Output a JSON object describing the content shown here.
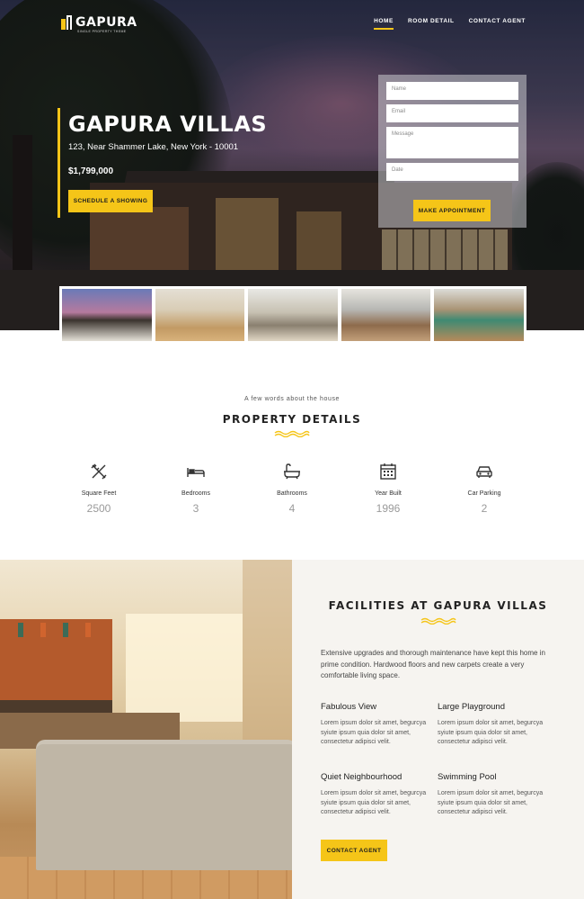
{
  "brand": {
    "name": "GAPURA",
    "tagline": "SINGLE PROPERTY THEME",
    "accent_color": "#f5c518"
  },
  "nav": {
    "items": [
      {
        "label": "HOME",
        "active": true
      },
      {
        "label": "ROOM DETAIL",
        "active": false
      },
      {
        "label": "CONTACT AGENT",
        "active": false
      }
    ]
  },
  "hero": {
    "title": "GAPURA VILLAS",
    "address": "123, Near Shammer Lake, New York - 10001",
    "price": "$1,799,000",
    "cta_label": "SCHEDULE A SHOWING"
  },
  "appointment": {
    "name_placeholder": "Name",
    "email_placeholder": "Email",
    "message_placeholder": "Message",
    "date_placeholder": "Date",
    "submit_label": "MAKE APPOINTMENT"
  },
  "gallery": {
    "thumbnails": [
      "exterior-dusk",
      "living-room",
      "lounge",
      "bedroom",
      "game-room"
    ]
  },
  "property_details": {
    "kicker": "A few words about the house",
    "heading_strong": "PROPERTY",
    "heading_light": "DETAILS",
    "stats": [
      {
        "icon": "ruler-pencil-icon",
        "label": "Square Feet",
        "value": "2500"
      },
      {
        "icon": "bed-icon",
        "label": "Bedrooms",
        "value": "3"
      },
      {
        "icon": "bathtub-icon",
        "label": "Bathrooms",
        "value": "4"
      },
      {
        "icon": "calendar-icon",
        "label": "Year Built",
        "value": "1996"
      },
      {
        "icon": "car-icon",
        "label": "Car Parking",
        "value": "2"
      }
    ]
  },
  "facilities": {
    "heading_strong": "FACILITIES",
    "heading_light": "AT GAPURA VILLAS",
    "intro": "Extensive upgrades and thorough maintenance have kept this home in prime condition. Hardwood floors and new carpets create a very comfortable living space.",
    "features": [
      {
        "title": "Fabulous View",
        "text": "Lorem ipsum dolor sit amet, begurcya syiute ipsum quia dolor sit amet, consectetur adipisci velit."
      },
      {
        "title": "Large Playground",
        "text": "Lorem ipsum dolor sit amet, begurcya syiute ipsum quia dolor sit amet, consectetur adipisci velit."
      },
      {
        "title": "Quiet Neighbourhood",
        "text": "Lorem ipsum dolor sit amet, begurcya syiute ipsum quia dolor sit amet, consectetur adipisci velit."
      },
      {
        "title": "Swimming Pool",
        "text": "Lorem ipsum dolor sit amet, begurcya syiute ipsum quia dolor sit amet, consectetur adipisci velit."
      }
    ],
    "cta_label": "CONTACT AGENT"
  }
}
